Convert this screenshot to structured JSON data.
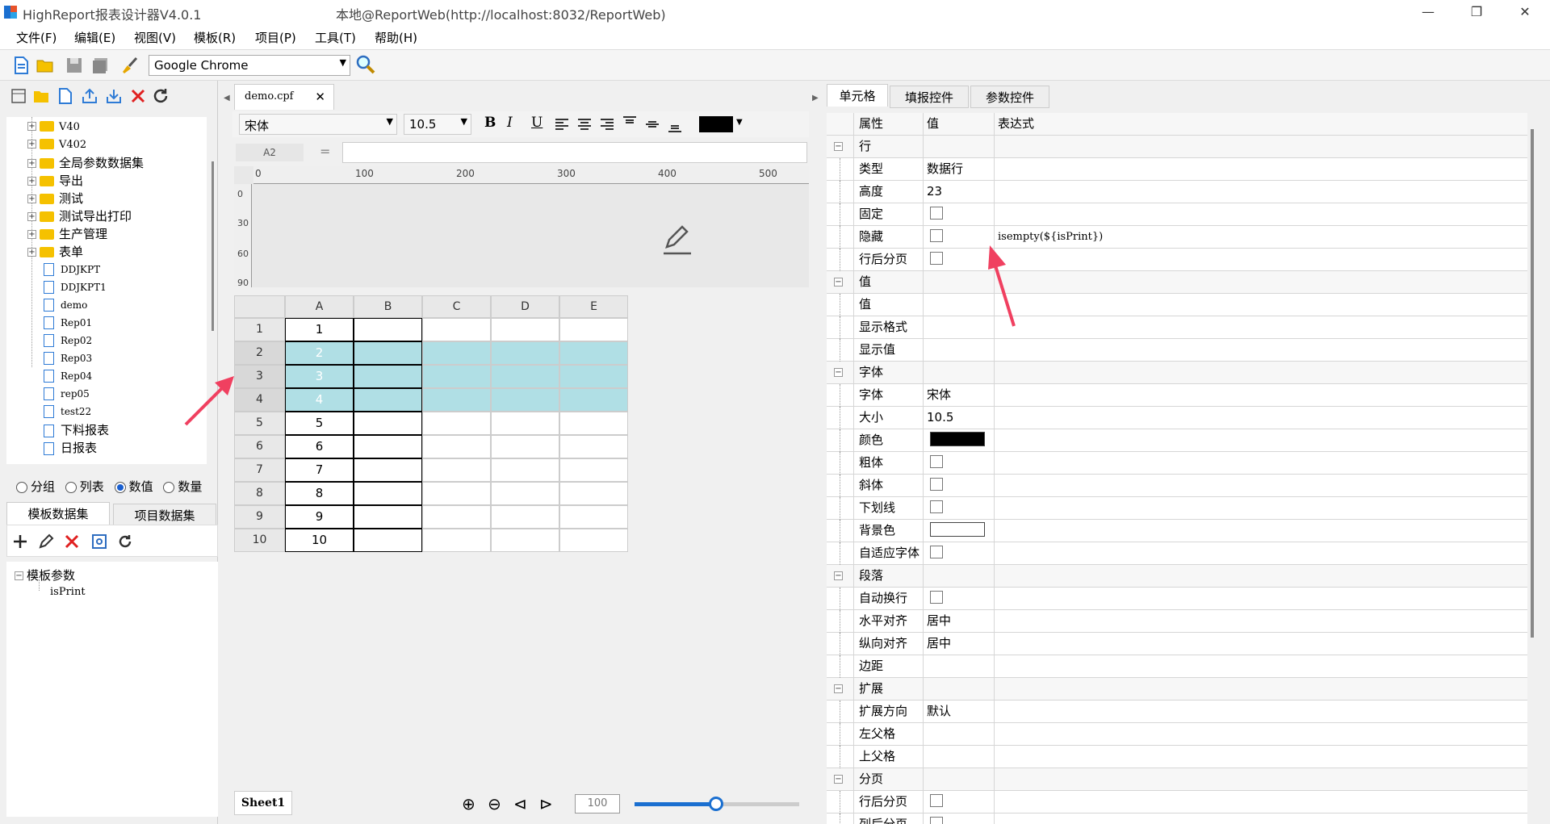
{
  "window": {
    "app_title": "HighReport报表设计器V4.0.1",
    "connection_title": "本地@ReportWeb(http://localhost:8032/ReportWeb)"
  },
  "menu": [
    "文件(F)",
    "编辑(E)",
    "视图(V)",
    "模板(R)",
    "项目(P)",
    "工具(T)",
    "帮助(H)"
  ],
  "toolbar": {
    "browser": "Google Chrome"
  },
  "tree": {
    "folders": [
      "V40",
      "V402",
      "全局参数数据集",
      "导出",
      "测试",
      "测试导出打印",
      "生产管理",
      "表单"
    ],
    "files": [
      "DDJKPT",
      "DDJKPT1",
      "demo",
      "Rep01",
      "Rep02",
      "Rep03",
      "Rep04",
      "rep05",
      "test22",
      "下料报表",
      "日报表"
    ]
  },
  "radios": [
    {
      "label": "分组",
      "checked": false
    },
    {
      "label": "列表",
      "checked": false
    },
    {
      "label": "数值",
      "checked": true
    },
    {
      "label": "数量",
      "checked": false
    }
  ],
  "dataset_tabs": [
    "模板数据集",
    "项目数据集"
  ],
  "params": {
    "root": "模板参数",
    "child": "isPrint"
  },
  "doc_tab": "demo.cpf",
  "format": {
    "font": "宋体",
    "size": "10.5",
    "bold": "B",
    "italic": "I",
    "underline": "U"
  },
  "formula": {
    "cell_ref": "A2",
    "eq": "=",
    "value": ""
  },
  "ruler_labels": [
    "0",
    "100",
    "200",
    "300",
    "400",
    "500"
  ],
  "ruler_v_labels": [
    "0",
    "30",
    "60",
    "90"
  ],
  "grid": {
    "columns": [
      "A",
      "B",
      "C",
      "D",
      "E"
    ],
    "rows": [
      "1",
      "2",
      "3",
      "4",
      "5",
      "6",
      "7",
      "8",
      "9",
      "10"
    ],
    "a_values": [
      "1",
      "2",
      "3",
      "4",
      "5",
      "6",
      "7",
      "8",
      "9",
      "10"
    ],
    "highlight_color": "#b0dfe5"
  },
  "sheet": {
    "name": "Sheet1",
    "zoom": "100"
  },
  "right_tabs": [
    "单元格",
    "填报控件",
    "参数控件"
  ],
  "prop_headers": {
    "name": "属性",
    "value": "值",
    "expr": "表达式"
  },
  "props": [
    {
      "group": true,
      "name": "行"
    },
    {
      "name": "类型",
      "value": "数据行"
    },
    {
      "name": "高度",
      "value": "23"
    },
    {
      "name": "固定",
      "check": true
    },
    {
      "name": "隐藏",
      "check": true,
      "expr": "isempty(${isPrint})"
    },
    {
      "name": "行后分页",
      "check": true
    },
    {
      "group": true,
      "name": "值"
    },
    {
      "name": "值"
    },
    {
      "name": "显示格式"
    },
    {
      "name": "显示值"
    },
    {
      "group": true,
      "name": "字体"
    },
    {
      "name": "字体",
      "value": "宋体"
    },
    {
      "name": "大小",
      "value": "10.5"
    },
    {
      "name": "颜色",
      "color": "#000000"
    },
    {
      "name": "粗体",
      "check": true
    },
    {
      "name": "斜体",
      "check": true
    },
    {
      "name": "下划线",
      "check": true
    },
    {
      "name": "背景色",
      "color": "#ffffff"
    },
    {
      "name": "自适应字体",
      "check": true
    },
    {
      "group": true,
      "name": "段落"
    },
    {
      "name": "自动换行",
      "check": true
    },
    {
      "name": "水平对齐",
      "value": "居中"
    },
    {
      "name": "纵向对齐",
      "value": "居中"
    },
    {
      "name": "边距"
    },
    {
      "group": true,
      "name": "扩展"
    },
    {
      "name": "扩展方向",
      "value": "默认"
    },
    {
      "name": "左父格"
    },
    {
      "name": "上父格"
    },
    {
      "group": true,
      "name": "分页"
    },
    {
      "name": "行后分页",
      "check": true
    },
    {
      "name": "列后分页",
      "check": true
    }
  ]
}
